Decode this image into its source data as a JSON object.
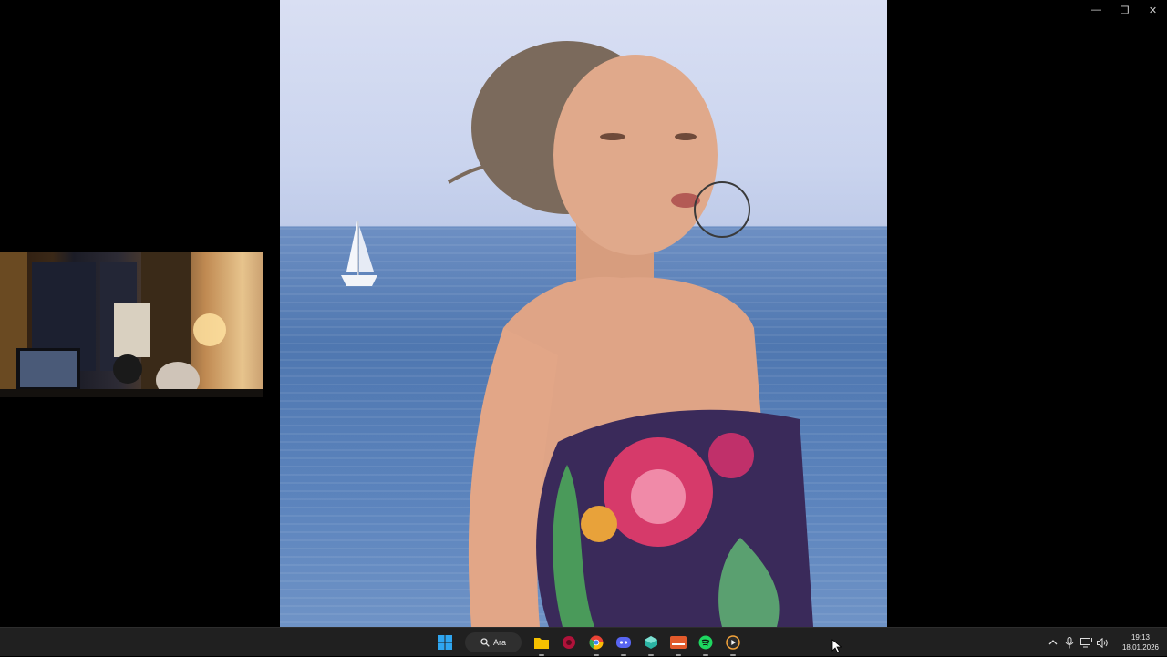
{
  "window_controls": {
    "minimize": "—",
    "restore": "❐",
    "close": "✕"
  },
  "taskbar": {
    "search_label": "Ara",
    "apps": [
      {
        "name": "start",
        "color": "#2fa6f0"
      },
      {
        "name": "file-explorer",
        "color": "#f5c000"
      },
      {
        "name": "app-red-circle",
        "color": "#b0123a"
      },
      {
        "name": "chrome",
        "color": "#34a853"
      },
      {
        "name": "discord",
        "color": "#5865f2"
      },
      {
        "name": "app-cube",
        "color": "#2bb3a3"
      },
      {
        "name": "voicemod",
        "color": "#e25a2b"
      },
      {
        "name": "spotify",
        "color": "#1ed760"
      },
      {
        "name": "media-player",
        "color": "#f3a33a"
      }
    ],
    "clock": {
      "time": "19:13",
      "date": "18.01.2026"
    }
  }
}
